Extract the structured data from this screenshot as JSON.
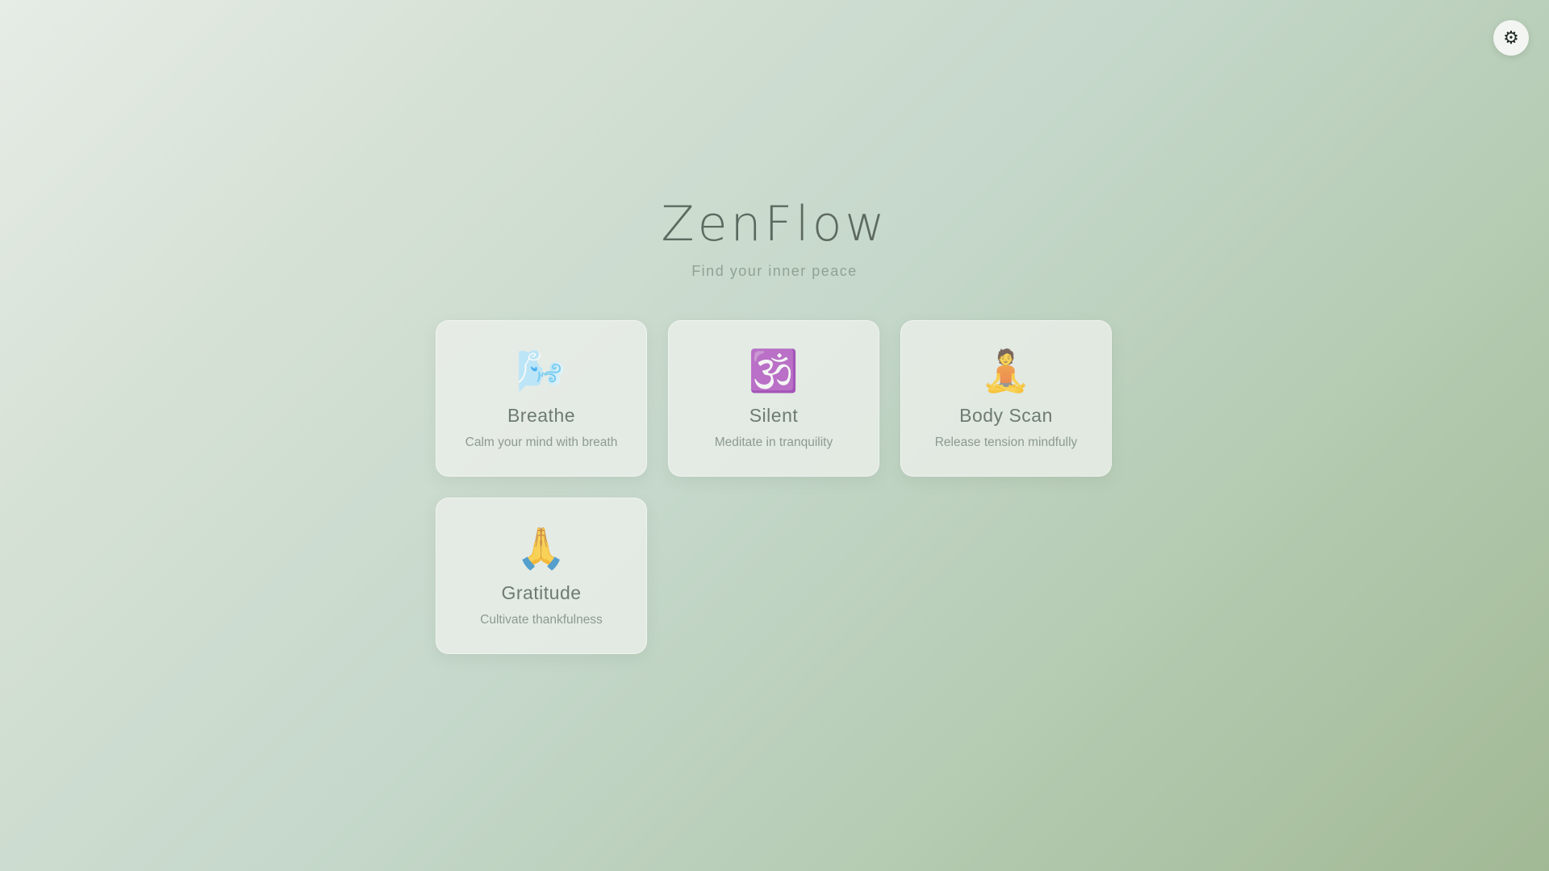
{
  "settings": {
    "icon": "⚙"
  },
  "header": {
    "title": "ZenFlow",
    "subtitle": "Find your inner peace"
  },
  "cards": [
    {
      "icon": "🌬️",
      "title": "Breathe",
      "description": "Calm your mind with breath"
    },
    {
      "icon": "🕉️",
      "title": "Silent",
      "description": "Meditate in tranquility"
    },
    {
      "icon": "🧘",
      "title": "Body Scan",
      "description": "Release tension mindfully"
    },
    {
      "icon": "🙏",
      "title": "Gratitude",
      "description": "Cultivate thankfulness"
    }
  ]
}
